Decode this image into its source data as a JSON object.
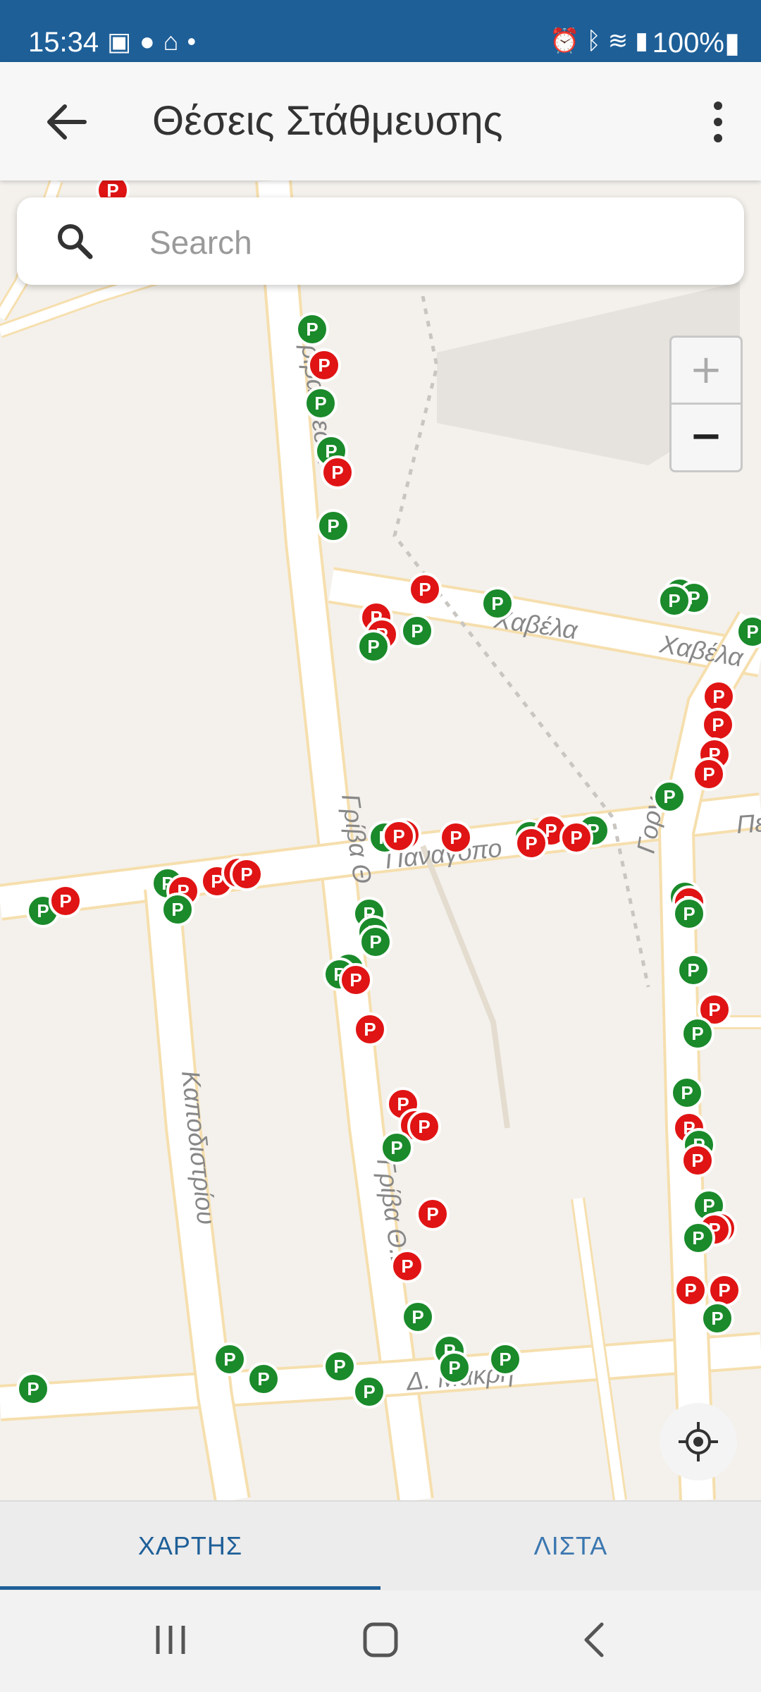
{
  "status_bar": {
    "time": "15:34",
    "left_icons": [
      "gallery-icon",
      "bulb-icon",
      "home-icon",
      "dot-icon"
    ],
    "right_icons": [
      "alarm-icon",
      "bluetooth-icon",
      "wifi-icon",
      "signal-icon"
    ],
    "battery": "100%"
  },
  "app_bar": {
    "title": "Θέσεις Στάθμευσης",
    "back_icon": "back-arrow-icon",
    "menu_icon": "more-vert-icon"
  },
  "search": {
    "placeholder": "Search",
    "value": ""
  },
  "map": {
    "street_names": [
      "Γρίβα Θεοδ.",
      "Χαβέλα",
      "Χαβέλα",
      "Παναγοπο",
      "Γρίβα Θ",
      "Καποδιστρίου",
      "Γρίβα Θ.Β.",
      "Δ. Μακρή",
      "Γοργ",
      "Πε"
    ],
    "marker_label": "P",
    "colors": {
      "free": "#1a8a2a",
      "occupied": "#e01414",
      "road": "#ffffff",
      "road_edge": "#f6dfae",
      "block": "#f4f1ec"
    }
  },
  "zoom": {
    "in_label": "+",
    "out_label": "−"
  },
  "tabs": [
    {
      "label": "ΧΑΡΤΗΣ",
      "active": true
    },
    {
      "label": "ΛΙΣΤΑ",
      "active": false
    }
  ],
  "nav_bar": [
    "recents-icon",
    "home-icon",
    "back-icon"
  ]
}
